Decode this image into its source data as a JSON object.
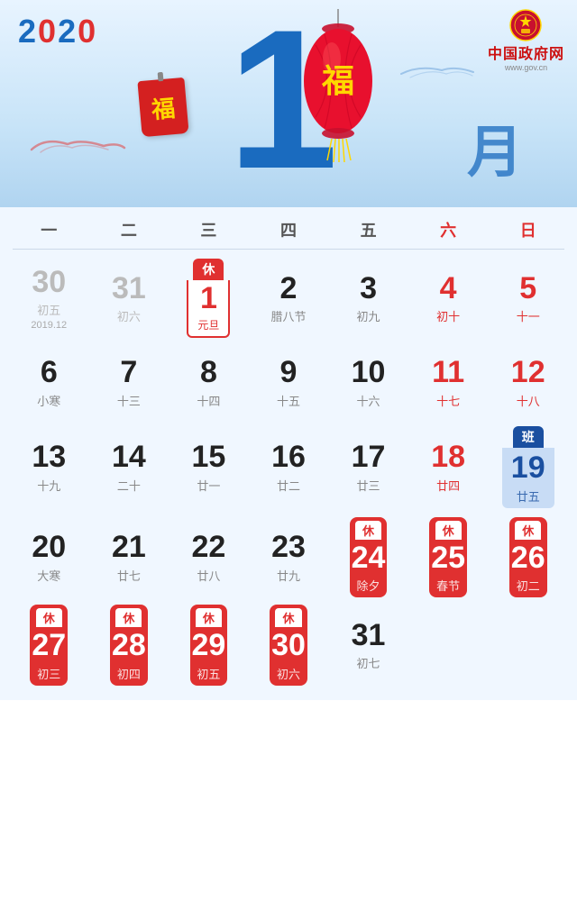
{
  "header": {
    "year": "2020",
    "month": "1",
    "yue": "月",
    "gov_name": "中国政府网",
    "gov_url": "www.gov.cn",
    "fu": "福"
  },
  "dow": [
    {
      "label": "一",
      "weekend": false
    },
    {
      "label": "二",
      "weekend": false
    },
    {
      "label": "三",
      "weekend": false
    },
    {
      "label": "四",
      "weekend": false
    },
    {
      "label": "五",
      "weekend": false
    },
    {
      "label": "六",
      "weekend": true
    },
    {
      "label": "日",
      "weekend": true
    }
  ],
  "weeks": [
    {
      "days": [
        {
          "num": "30",
          "sub": "初五",
          "type": "gray",
          "prevMonth": true
        },
        {
          "num": "31",
          "sub": "初六",
          "type": "gray",
          "prevMonth": true
        },
        {
          "num": "1",
          "sub": "元旦",
          "type": "yuandan",
          "badge": "休"
        },
        {
          "num": "2",
          "sub": "腊八节",
          "type": "normal"
        },
        {
          "num": "3",
          "sub": "初九",
          "type": "normal"
        },
        {
          "num": "4",
          "sub": "初十",
          "type": "red"
        },
        {
          "num": "5",
          "sub": "十一",
          "type": "red"
        },
        {
          "prevMonthLabel": "2019.12",
          "colSpan": 2
        }
      ]
    },
    {
      "days": [
        {
          "num": "6",
          "sub": "小寒",
          "type": "normal"
        },
        {
          "num": "7",
          "sub": "十三",
          "type": "normal"
        },
        {
          "num": "8",
          "sub": "十四",
          "type": "normal"
        },
        {
          "num": "9",
          "sub": "十五",
          "type": "normal"
        },
        {
          "num": "10",
          "sub": "十六",
          "type": "normal"
        },
        {
          "num": "11",
          "sub": "十七",
          "type": "red"
        },
        {
          "num": "12",
          "sub": "十八",
          "type": "red"
        }
      ]
    },
    {
      "days": [
        {
          "num": "13",
          "sub": "十九",
          "type": "normal"
        },
        {
          "num": "14",
          "sub": "二十",
          "type": "normal"
        },
        {
          "num": "15",
          "sub": "廿一",
          "type": "normal"
        },
        {
          "num": "16",
          "sub": "廿二",
          "type": "normal"
        },
        {
          "num": "17",
          "sub": "廿三",
          "type": "normal"
        },
        {
          "num": "18",
          "sub": "廿四",
          "type": "red"
        },
        {
          "num": "19",
          "sub": "廿五",
          "type": "ban",
          "badge": "班"
        }
      ]
    },
    {
      "days": [
        {
          "num": "20",
          "sub": "大寒",
          "type": "normal"
        },
        {
          "num": "21",
          "sub": "廿七",
          "type": "normal"
        },
        {
          "num": "22",
          "sub": "廿八",
          "type": "normal"
        },
        {
          "num": "23",
          "sub": "廿九",
          "type": "normal"
        },
        {
          "num": "24",
          "sub": "除夕",
          "type": "holiday",
          "badge": "休"
        },
        {
          "num": "25",
          "sub": "春节",
          "type": "holiday",
          "badge": "休"
        },
        {
          "num": "26",
          "sub": "初二",
          "type": "holiday",
          "badge": "休"
        }
      ]
    },
    {
      "days": [
        {
          "num": "27",
          "sub": "初三",
          "type": "holiday",
          "badge": "休"
        },
        {
          "num": "28",
          "sub": "初四",
          "type": "holiday",
          "badge": "休"
        },
        {
          "num": "29",
          "sub": "初五",
          "type": "holiday",
          "badge": "休"
        },
        {
          "num": "30",
          "sub": "初六",
          "type": "holiday",
          "badge": "休"
        },
        {
          "num": "31",
          "sub": "初七",
          "type": "normal"
        },
        {
          "type": "empty"
        },
        {
          "type": "empty"
        }
      ]
    }
  ]
}
